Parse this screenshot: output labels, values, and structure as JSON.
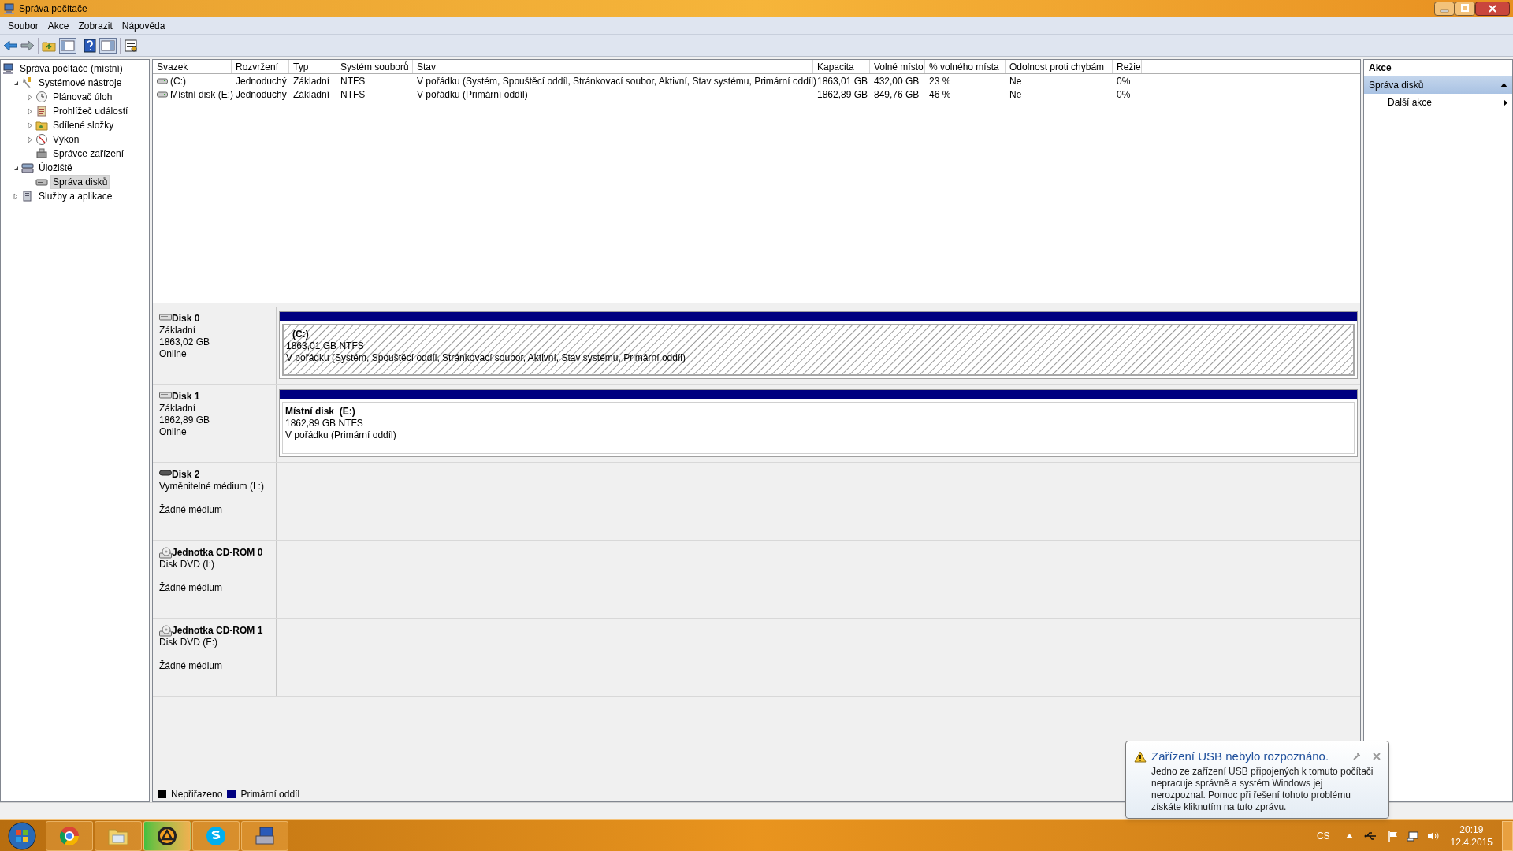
{
  "window": {
    "title": "Správa počítače"
  },
  "menu": [
    "Soubor",
    "Akce",
    "Zobrazit",
    "Nápověda"
  ],
  "tree": [
    {
      "label": "Správa počítače (místní)",
      "selected": false,
      "children": [
        {
          "label": "Systémové nástroje",
          "expanded": true,
          "selected": false,
          "children": [
            {
              "label": "Plánovač úloh",
              "expanded": false,
              "selected": false
            },
            {
              "label": "Prohlížeč událostí",
              "expanded": false,
              "selected": false
            },
            {
              "label": "Sdílené složky",
              "expanded": false,
              "selected": false
            },
            {
              "label": "Výkon",
              "expanded": false,
              "selected": false
            },
            {
              "label": "Správce zařízení",
              "selected": false
            }
          ]
        },
        {
          "label": "Úložiště",
          "expanded": true,
          "selected": false,
          "children": [
            {
              "label": "Správa disků",
              "selected": true
            }
          ]
        },
        {
          "label": "Služby a aplikace",
          "expanded": false,
          "selected": false
        }
      ]
    }
  ],
  "table": {
    "columns": [
      "Svazek",
      "Rozvržení",
      "Typ",
      "Systém souborů",
      "Stav",
      "Kapacita",
      "Volné místo",
      "% volného místa",
      "Odolnost proti chybám",
      "Režie"
    ],
    "rows": [
      {
        "cells": [
          "(C:)",
          "Jednoduchý",
          "Základní",
          "NTFS",
          "V pořádku (Systém, Spouštěcí oddíl, Stránkovací soubor, Aktivní, Stav systému, Primární oddíl)",
          "1863,01 GB",
          "432,00 GB",
          "23 %",
          "Ne",
          "0%"
        ]
      },
      {
        "cells": [
          "Místní disk (E:)",
          "Jednoduchý",
          "Základní",
          "NTFS",
          "V pořádku (Primární oddíl)",
          "1862,89 GB",
          "849,76 GB",
          "46 %",
          "Ne",
          "0%"
        ]
      }
    ]
  },
  "disks": [
    {
      "name": "Disk 0",
      "kind": "disk",
      "lines": [
        "Základní",
        "1863,02 GB"
      ],
      "status": "Online",
      "partition": {
        "label": "(C:)",
        "size": "1863,01 GB NTFS",
        "status": "V pořádku (Systém, Spouštěcí oddíl, Stránkovací soubor, Aktivní, Stav systému, Primární oddíl)",
        "selected": true
      }
    },
    {
      "name": "Disk 1",
      "kind": "disk",
      "lines": [
        "Základní",
        "1862,89 GB"
      ],
      "status": "Online",
      "partition": {
        "label": "Místní disk  (E:)",
        "size": "1862,89 GB NTFS",
        "status": "V pořádku (Primární oddíl)",
        "selected": false
      }
    },
    {
      "name": "Disk 2",
      "kind": "removable",
      "lines": [
        "Vyměnitelné médium (L:)"
      ],
      "status": "Žádné médium"
    },
    {
      "name": "Jednotka CD-ROM 0",
      "kind": "cdrom",
      "lines": [
        "Disk DVD (I:)"
      ],
      "status": "Žádné médium"
    },
    {
      "name": "Jednotka CD-ROM 1",
      "kind": "cdrom",
      "lines": [
        "Disk DVD (F:)"
      ],
      "status": "Žádné médium"
    }
  ],
  "legend": [
    {
      "label": "Nepřiřazeno",
      "color": "#000000"
    },
    {
      "label": "Primární oddíl",
      "color": "#000080"
    }
  ],
  "actions": {
    "title": "Akce",
    "section": {
      "label": "Správa disků",
      "expanded": true
    },
    "items": [
      "Další akce"
    ]
  },
  "notification": {
    "title": "Zařízení USB nebylo rozpoznáno.",
    "body": "Jedno ze zařízení USB připojených k tomuto počítači nepracuje správně a systém Windows jej nerozpoznal. Pomoc při řešení tohoto problému získáte kliknutím na tuto zprávu."
  },
  "tray": {
    "language": "CS",
    "time": "20:19",
    "date": "12.4.2015"
  }
}
